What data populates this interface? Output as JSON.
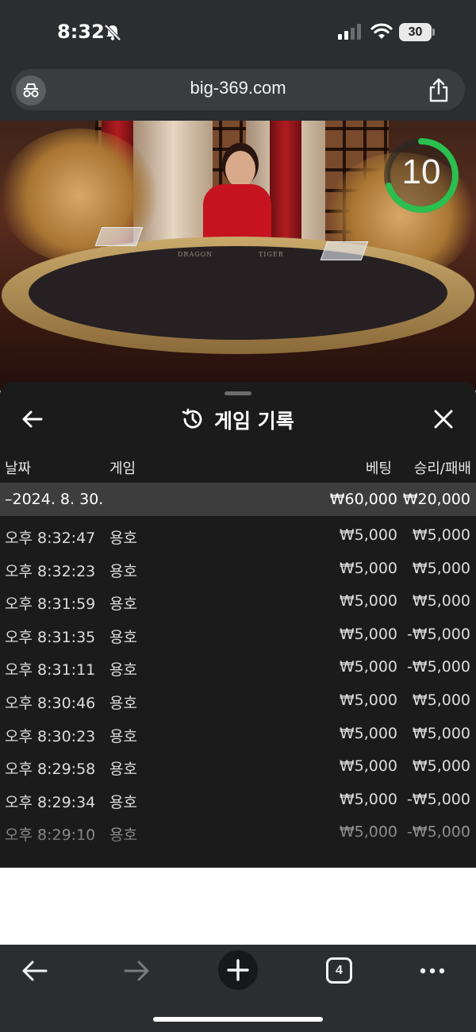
{
  "status_bar": {
    "time": "8:32",
    "battery_percent": "30",
    "icons": [
      "bell-slash-icon",
      "cellular-signal-icon",
      "wifi-icon",
      "battery-icon"
    ]
  },
  "browser": {
    "url": "big-369.com",
    "left_icon": "incognito-icon",
    "right_icon": "share-icon",
    "tab_count": "4",
    "toolbar_icons": [
      "back-icon",
      "forward-icon",
      "new-tab-plus-icon",
      "tab-switcher-icon",
      "more-icon"
    ]
  },
  "video": {
    "countdown": "10",
    "countdown_fraction": 0.7,
    "table_labels": [
      "DRAGON",
      "TIGER"
    ]
  },
  "history_panel": {
    "title": "게임 기록",
    "title_icon": "history-icon",
    "back_icon": "back-arrow-icon",
    "close_icon": "close-icon",
    "columns": {
      "date": "날짜",
      "game": "게임",
      "bet": "베팅",
      "result": "승리/패배"
    },
    "group": {
      "date": "–2024. 8. 30.",
      "total_bet": "₩60,000",
      "total_result": "₩20,000"
    },
    "rows": [
      {
        "time": "오후 8:32:47",
        "game": "용호",
        "bet": "₩5,000",
        "result": "₩5,000"
      },
      {
        "time": "오후 8:32:23",
        "game": "용호",
        "bet": "₩5,000",
        "result": "₩5,000"
      },
      {
        "time": "오후 8:31:59",
        "game": "용호",
        "bet": "₩5,000",
        "result": "₩5,000"
      },
      {
        "time": "오후 8:31:35",
        "game": "용호",
        "bet": "₩5,000",
        "result": "-₩5,000"
      },
      {
        "time": "오후 8:31:11",
        "game": "용호",
        "bet": "₩5,000",
        "result": "-₩5,000"
      },
      {
        "time": "오후 8:30:46",
        "game": "용호",
        "bet": "₩5,000",
        "result": "₩5,000"
      },
      {
        "time": "오후 8:30:23",
        "game": "용호",
        "bet": "₩5,000",
        "result": "₩5,000"
      },
      {
        "time": "오후 8:29:58",
        "game": "용호",
        "bet": "₩5,000",
        "result": "₩5,000"
      },
      {
        "time": "오후 8:29:34",
        "game": "용호",
        "bet": "₩5,000",
        "result": "-₩5,000"
      },
      {
        "time": "오후 8:29:10",
        "game": "용호",
        "bet": "₩5,000",
        "result": "-₩5,000"
      }
    ]
  },
  "colors": {
    "timer_ring": "#2bbf4f",
    "panel_bg": "#1b1b1b",
    "group_row_bg": "#3d3d3d",
    "browser_chrome": "#2c2d2f"
  }
}
